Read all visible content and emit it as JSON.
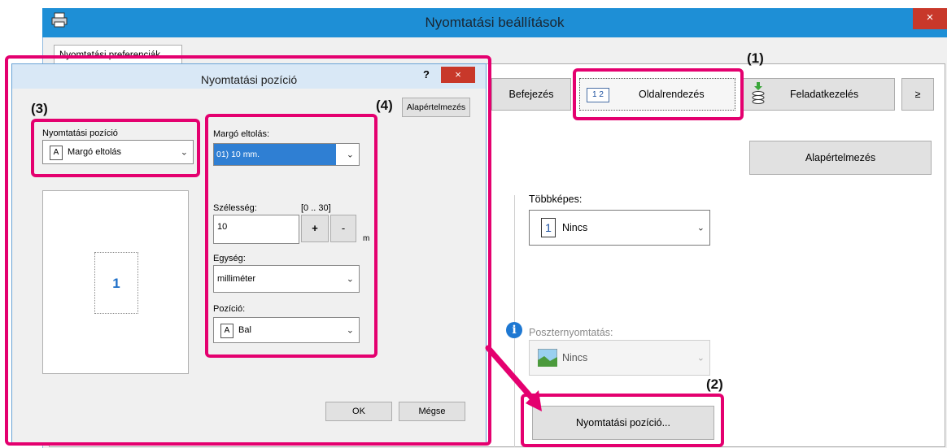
{
  "main_window": {
    "title": "Nyomtatási beállítások",
    "close_label": "×",
    "pref_tab_label": "Nyomtatási preferenciák",
    "tabs": [
      {
        "label": "Befejezés"
      },
      {
        "label": "Oldalrendezés",
        "icon_text": "1 2"
      },
      {
        "label": "Feladatkezelés"
      },
      {
        "label": "≥"
      }
    ],
    "default_button": "Alapértelmezés",
    "multi_page": {
      "label": "Többképes:",
      "icon_text": "1",
      "value": "Nincs"
    },
    "poster": {
      "label": "Poszternyomtatás:",
      "value": "Nincs"
    },
    "position_button": "Nyomtatási pozíció..."
  },
  "dialog": {
    "title": "Nyomtatási pozíció",
    "help_label": "?",
    "close_label": "×",
    "position_label": "Nyomtatási pozíció",
    "position_value": "Margó eltolás",
    "position_icon_text": "A",
    "preview_page": "1",
    "default_button": "Alapértelmezés",
    "margin_label": "Margó eltolás:",
    "margin_value": "01) 10 mm.",
    "width_label": "Szélesség:",
    "width_range": "[0 .. 30]",
    "width_value": "10",
    "plus_label": "+",
    "minus_label": "-",
    "unit_short": "m",
    "unit_label": "Egység:",
    "unit_value": "milliméter",
    "pos_label": "Pozíció:",
    "pos_value": "Bal",
    "pos_icon_text": "A",
    "ok_button": "OK",
    "cancel_button": "Mégse"
  },
  "annotations": {
    "n1": "(1)",
    "n2": "(2)",
    "n3": "(3)",
    "n4": "(4)"
  },
  "colors": {
    "titlebar": "#1e8fd6",
    "highlight": "#e4006f",
    "selection": "#2f7fd3",
    "close": "#c8382a"
  }
}
